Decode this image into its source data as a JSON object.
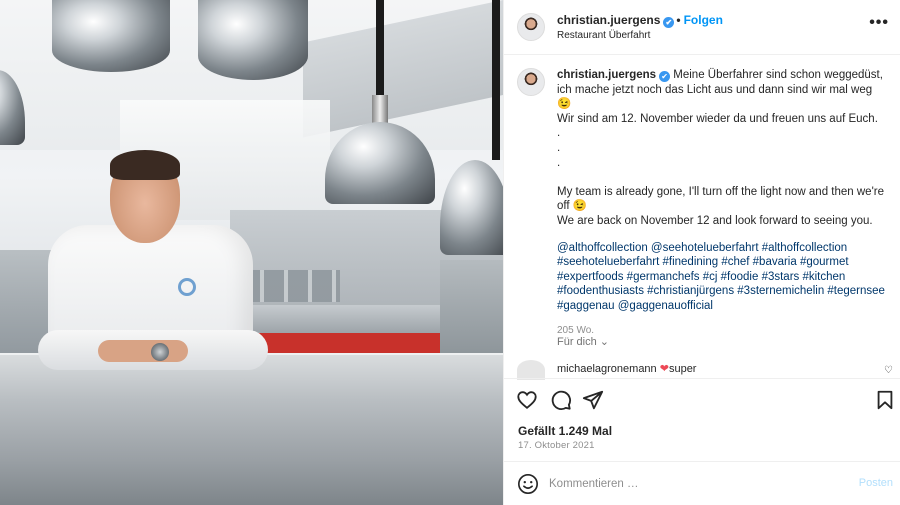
{
  "post": {
    "username": "christian.juergens",
    "verified_mark": "✔",
    "separator": "•",
    "follow_label": "Folgen",
    "location": "Restaurant Überfahrt",
    "more_label": "•••"
  },
  "caption": {
    "username": "christian.juergens",
    "text_de": "Meine Überfahrer sind schon weggedüst, ich mache jetzt noch das Licht aus und dann sind wir mal weg 😉\nWir sind am 12. November wieder da und freuen uns auf Euch.\n.\n.\n.\n\nMy team is already gone, I'll turn off the light now and then we're off 😉\nWe are back on November 12 and look forward to seeing you.",
    "hashtags": "@althoffcollection @seehotelueberfahrt #althoffcollection #seehotelueberfahrt #finedining #chef #bavaria #gourmet #expertfoods #germanchefs #cj #foodie #3stars #kitchen #foodenthusiasts #christianjürgens #3sternemichelin #tegernsee #gaggenau @gaggenauofficial",
    "word_count": "205 Wo.",
    "for_you_label": "Für dich ⌄"
  },
  "comment": {
    "username": "michaelagronemann",
    "heart": "❤",
    "text": "super",
    "like_icon": "♡"
  },
  "actions": {
    "likes": "Gefällt 1.249 Mal",
    "date": "17. Oktober 2021"
  },
  "comment_box": {
    "placeholder": "Kommentieren …",
    "post_label": "Posten"
  },
  "icons": {
    "like": "heart-outline-icon",
    "comment": "comment-bubble-icon",
    "share": "paper-plane-icon",
    "save": "bookmark-icon",
    "emoji": "smiley-icon"
  },
  "colors": {
    "link_blue": "#0095f6",
    "hashtag": "#00376b",
    "verified": "#3897f0",
    "muted": "#8e8e8e",
    "post_disabled": "#b2dffc"
  }
}
